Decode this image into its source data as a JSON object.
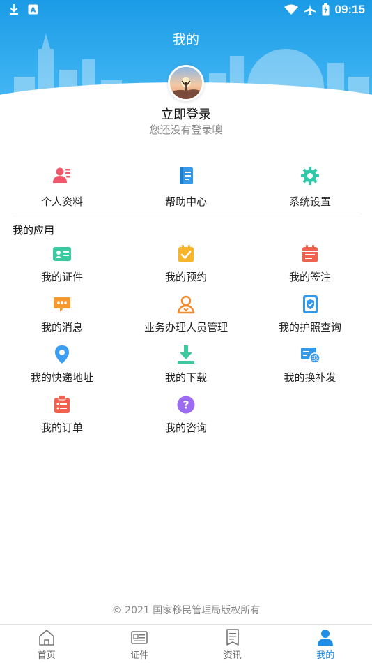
{
  "status_bar": {
    "time": "09:15"
  },
  "header": {
    "title": "我的"
  },
  "profile": {
    "login_label": "立即登录",
    "subtitle": "您还没有登录噢"
  },
  "quick_menu": [
    {
      "label": "个人资料",
      "icon": "person-card-icon",
      "color": "#f2566a"
    },
    {
      "label": "帮助中心",
      "icon": "book-icon",
      "color": "#3399e8"
    },
    {
      "label": "系统设置",
      "icon": "gear-icon",
      "color": "#2fc8a9"
    }
  ],
  "apps_section": {
    "title": "我的应用",
    "items": [
      {
        "label": "我的证件",
        "icon": "id-card-icon",
        "color": "#3cc9a0"
      },
      {
        "label": "我的预约",
        "icon": "calendar-check-icon",
        "color": "#f7b52c"
      },
      {
        "label": "我的签注",
        "icon": "calendar-icon",
        "color": "#f2604e"
      },
      {
        "label": "我的消息",
        "icon": "message-icon",
        "color": "#f79a2e"
      },
      {
        "label": "业务办理人员管理",
        "icon": "user-outline-icon",
        "color": "#f28a2e"
      },
      {
        "label": "我的护照查询",
        "icon": "passport-icon",
        "color": "#3399e8"
      },
      {
        "label": "我的快递地址",
        "icon": "location-pin-icon",
        "color": "#3b9ef0"
      },
      {
        "label": "我的下载",
        "icon": "download-icon",
        "color": "#3cc9a0"
      },
      {
        "label": "我的换补发",
        "icon": "card-exchange-icon",
        "color": "#3399e8"
      },
      {
        "label": "我的订单",
        "icon": "order-list-icon",
        "color": "#f2604e"
      },
      {
        "label": "我的咨询",
        "icon": "question-icon",
        "color": "#9b6cf0"
      }
    ]
  },
  "footer": {
    "copyright": "© 2021 国家移民管理局版权所有"
  },
  "tabbar": {
    "tabs": [
      {
        "label": "首页",
        "icon": "home-icon",
        "active": false
      },
      {
        "label": "证件",
        "icon": "document-card-icon",
        "active": false
      },
      {
        "label": "资讯",
        "icon": "news-icon",
        "active": false
      },
      {
        "label": "我的",
        "icon": "person-icon",
        "active": true
      }
    ]
  },
  "colors": {
    "header_blue": "#1b9be6",
    "active_tab": "#1e8ee6"
  }
}
